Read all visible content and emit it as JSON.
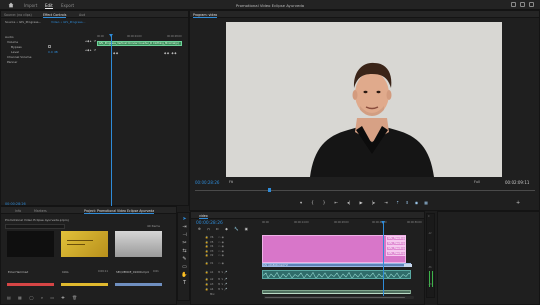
{
  "topbar": {
    "tabs": [
      "Import",
      "Edit",
      "Export"
    ],
    "active_tab": "Edit",
    "title": "Promotional Video Eclipse Ayurveda"
  },
  "effect_controls": {
    "tabs": [
      "Source: (no clips)",
      "Effect Controls",
      "Aud"
    ],
    "source_label": "Source • Gfx_Progress...",
    "clip_label": "Video • Gfx_Progress...",
    "track_clip_label": "Gfx_Progress_Vertical Circular Counter_D Clothing_Minimal(p)",
    "ruler_start": "00:00",
    "ruler_mid": "00:00:04:00",
    "ruler_end": "00:00:08:00",
    "rows": [
      {
        "label": "Audio",
        "value": ""
      },
      {
        "label": "Volume",
        "value": ""
      },
      {
        "label": "Bypass",
        "value": ""
      },
      {
        "label": "Level",
        "value": "0.0 dB"
      },
      {
        "label": "Channel Volume",
        "value": ""
      },
      {
        "label": "Panner",
        "value": ""
      }
    ],
    "timecode": "00:00:28:26"
  },
  "program": {
    "tab": "Program: video",
    "timecode": "00:00:28:26",
    "fit": "Fit",
    "quality": "Full",
    "duration": "00:02:09:11"
  },
  "project": {
    "tabs": [
      "Info",
      "Markers",
      "Project: Promotional Video Eclipse Ayurveda"
    ],
    "path": "Promotional Video Eclipse Ayurveda.prproj",
    "count": "40 Items",
    "items": [
      {
        "name": "Eclai Hammad",
        "duration": "",
        "color": "#d64545"
      },
      {
        "name": "Intro",
        "duration": "0:09:11",
        "color": "#e0b92e"
      },
      {
        "name": "SEQUENCE_01000.mp4",
        "duration": "0:01",
        "color": "#6f8fc0"
      }
    ]
  },
  "timeline": {
    "tab": "video",
    "timecode": "00:00:28:26",
    "ruler": [
      "00:00",
      "00:00:14:00",
      "00:00:28:00",
      "00:00:42:00",
      "00:00:56:00"
    ],
    "video_tracks": [
      "V6",
      "V5",
      "V4",
      "V3",
      "V2",
      "V1"
    ],
    "audio_tracks": [
      "A1",
      "A2",
      "A3",
      "A4",
      "Mix"
    ],
    "graphic_labels": [
      "Gfx_Heading",
      "Gfx_Heading",
      "Gfx_Heading",
      "Gfx_Heading"
    ],
    "v1_clip": "Gfx_ACLEAR.mp4 [V]",
    "meter_ticks": [
      "0",
      "-12",
      "-24",
      "-36",
      "-48"
    ]
  }
}
